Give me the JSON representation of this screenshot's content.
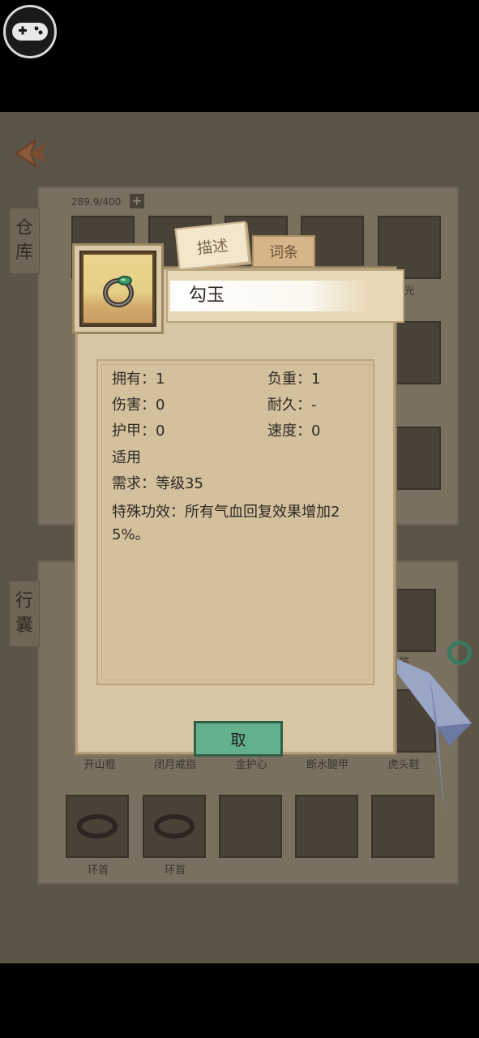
{
  "overlay": {
    "gamepad_icon": "gamepad-icon"
  },
  "warehouse": {
    "tab_label": [
      "仓",
      "库"
    ],
    "capacity": "289.9/400",
    "add_label": "+",
    "partial_label": "光"
  },
  "bag": {
    "tab_label": [
      "行",
      "囊"
    ],
    "row_labels": [
      "开山棍",
      "闭月戒指",
      "金护心",
      "断水腿甲",
      "虎头鞋"
    ],
    "bottom_labels": [
      "环首",
      "环首"
    ],
    "partial_label": "笛"
  },
  "dialog": {
    "tabs": {
      "description": "描述",
      "entries": "词条"
    },
    "item_name": "勾玉",
    "stats": {
      "own": "拥有：1",
      "weight": "负重：1",
      "damage": "伤害：0",
      "durability": "耐久：-",
      "armor": "护甲：0",
      "speed": "速度：0",
      "applicable": "适用",
      "requirement": "需求：等级35",
      "special": "特殊功效：所有气血回复效果增加25%。"
    },
    "take_button": "取"
  },
  "colors": {
    "take_button": "#63b08c",
    "dialog_bg": "#d7c6a3"
  }
}
